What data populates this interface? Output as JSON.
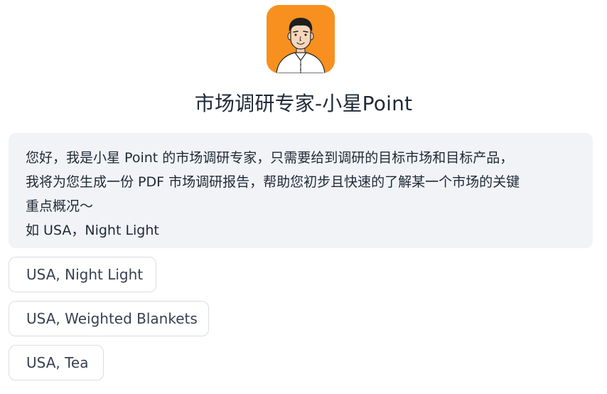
{
  "bot": {
    "name": "市场调研专家-小星Point",
    "avatar_icon": "cartoon-man-avatar-icon",
    "avatar_bg": "#f7901e"
  },
  "intro": {
    "lines": [
      "您好，我是小星 Point 的市场调研专家，只需要给到调研的目标市场和目标产品，",
      "我将为您生成一份 PDF 市场调研报告，帮助您初步且快速的了解某一个市场的关键",
      "重点概况～",
      "如 USA，Night Light"
    ]
  },
  "suggestions": [
    {
      "label": "USA, Night Light"
    },
    {
      "label": "USA, Weighted Blankets"
    },
    {
      "label": "USA, Tea"
    }
  ]
}
